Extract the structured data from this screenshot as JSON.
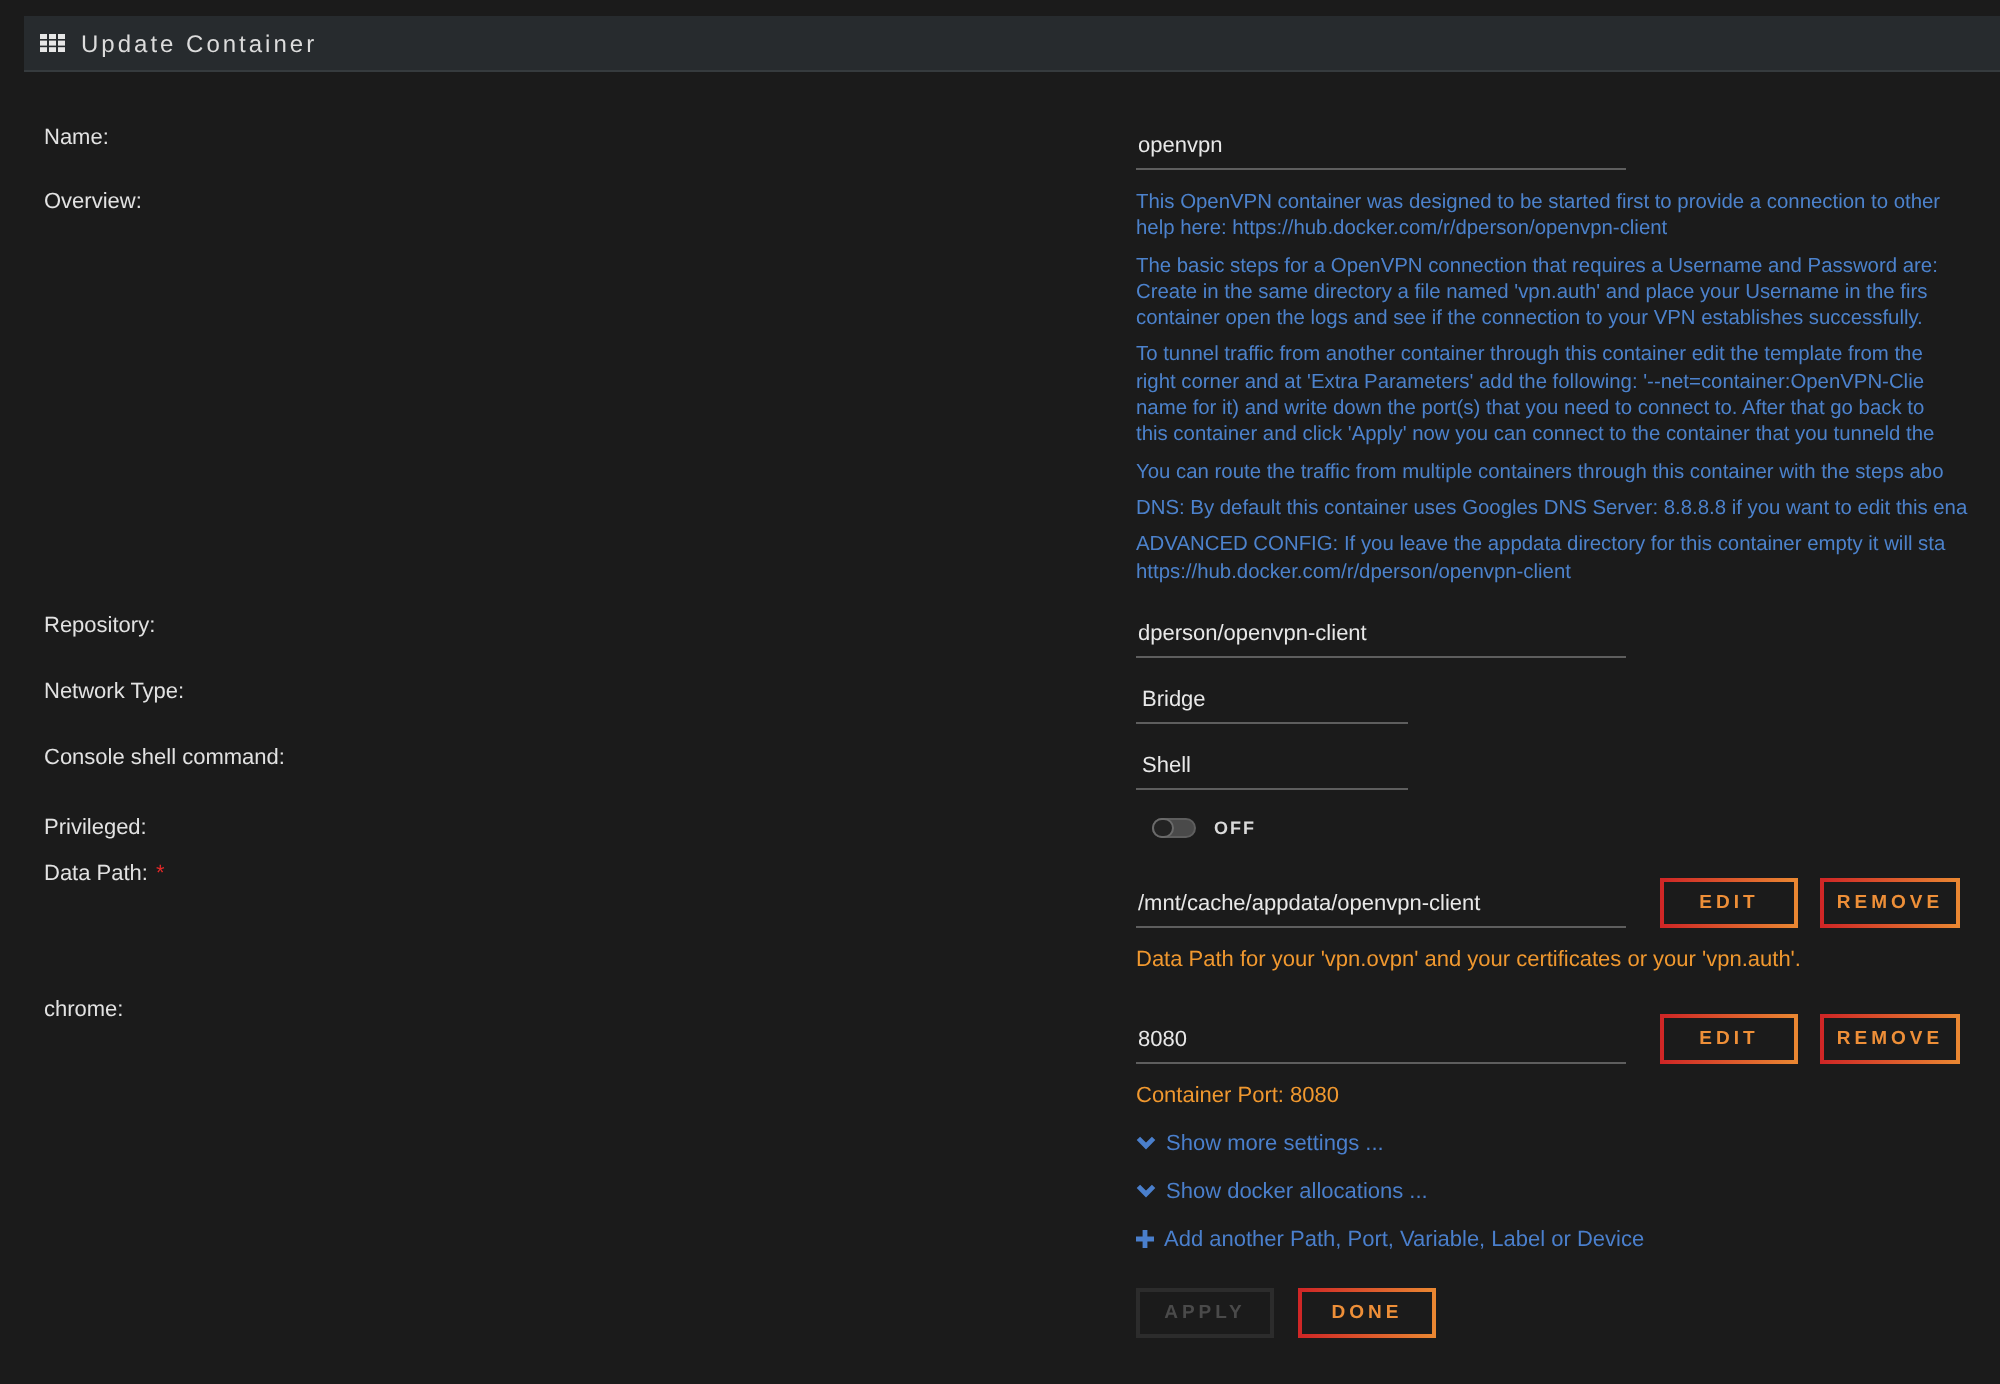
{
  "window": {
    "title": "Update Container"
  },
  "form": {
    "fields": [
      {
        "kind": "text",
        "label": "Name:",
        "value": "openvpn"
      },
      {
        "kind": "overview",
        "label": "Overview:",
        "paragraphs": [
          {
            "lines": [
              "This OpenVPN container was designed to be started first to provide a connection to other",
              "help here: https://hub.docker.com/r/dperson/openvpn-client"
            ]
          },
          {
            "lines": [
              "The basic steps for a OpenVPN connection that requires a Username and Password are:",
              "Create in the same directory a file named 'vpn.auth' and place your Username in the firs",
              "container open the logs and see if the connection to your VPN establishes successfully."
            ]
          },
          {
            "lines": [
              "To tunnel traffic from another container through this container edit the template from the",
              "right corner and at 'Extra Parameters' add the following: '--net=container:OpenVPN-Clie",
              "name for it) and write down the port(s) that you need to connect to. After that go back to",
              "this container and click 'Apply' now you can connect to the container that you tunneld the"
            ]
          },
          {
            "lines": [
              "You can route the traffic from multiple containers through this container with the steps abo"
            ]
          },
          {
            "lines": [
              "DNS: By default this container uses Googles DNS Server: 8.8.8.8 if you want to edit this ena"
            ]
          },
          {
            "lines": [
              "ADVANCED CONFIG: If you leave the appdata directory for this container empty it will sta",
              "https://hub.docker.com/r/dperson/openvpn-client"
            ]
          }
        ]
      },
      {
        "kind": "text",
        "label": "Repository:",
        "value": "dperson/openvpn-client"
      },
      {
        "kind": "select",
        "label": "Network Type:",
        "value": "Bridge"
      },
      {
        "kind": "select",
        "label": "Console shell command:",
        "value": "Shell"
      },
      {
        "kind": "switch",
        "label": "Privileged:",
        "on": false,
        "state_label": "OFF"
      },
      {
        "kind": "config",
        "label": "Data Path:",
        "required_mark": "*",
        "value": "/mnt/cache/appdata/openvpn-client",
        "buttons": [
          "EDIT",
          "REMOVE"
        ],
        "description": "Data Path for your 'vpn.ovpn' and your certificates or your 'vpn.auth'."
      },
      {
        "kind": "config",
        "label": "chrome:",
        "value": "8080",
        "buttons": [
          "EDIT",
          "REMOVE"
        ],
        "description": "Container Port: 8080"
      }
    ],
    "links": [
      {
        "kind": "expand",
        "label": "Show more settings ..."
      },
      {
        "kind": "expand",
        "label": "Show docker allocations ..."
      },
      {
        "kind": "add",
        "label": "Add another Path, Port, Variable, Label or Device"
      }
    ],
    "actions": [
      {
        "label": "APPLY",
        "disabled": true
      },
      {
        "label": "DONE",
        "disabled": false
      }
    ]
  }
}
